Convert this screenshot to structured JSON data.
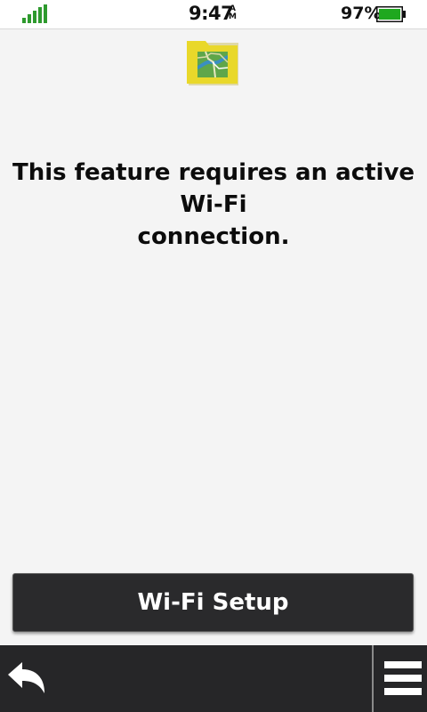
{
  "status_bar": {
    "time": "9:47",
    "am_pm_top": "A",
    "am_pm_bottom": "M",
    "battery_percent": "97%",
    "signal_icon": "signal-bars-icon",
    "battery_icon": "battery-icon"
  },
  "app": {
    "icon": "map-folder-icon"
  },
  "message": {
    "line1": "This feature requires an active Wi-Fi",
    "line2": "connection."
  },
  "actions": {
    "wifi_setup_label": "Wi-Fi Setup"
  },
  "bottom_bar": {
    "back_icon": "back-arrow-icon",
    "menu_icon": "menu-icon"
  },
  "colors": {
    "background": "#f4f4f4",
    "button": "#2a2a2c",
    "bottom_bar": "#262628",
    "signal_green": "#2e9a2e",
    "battery_green": "#1fa81f",
    "folder_yellow": "#e9d82a"
  }
}
